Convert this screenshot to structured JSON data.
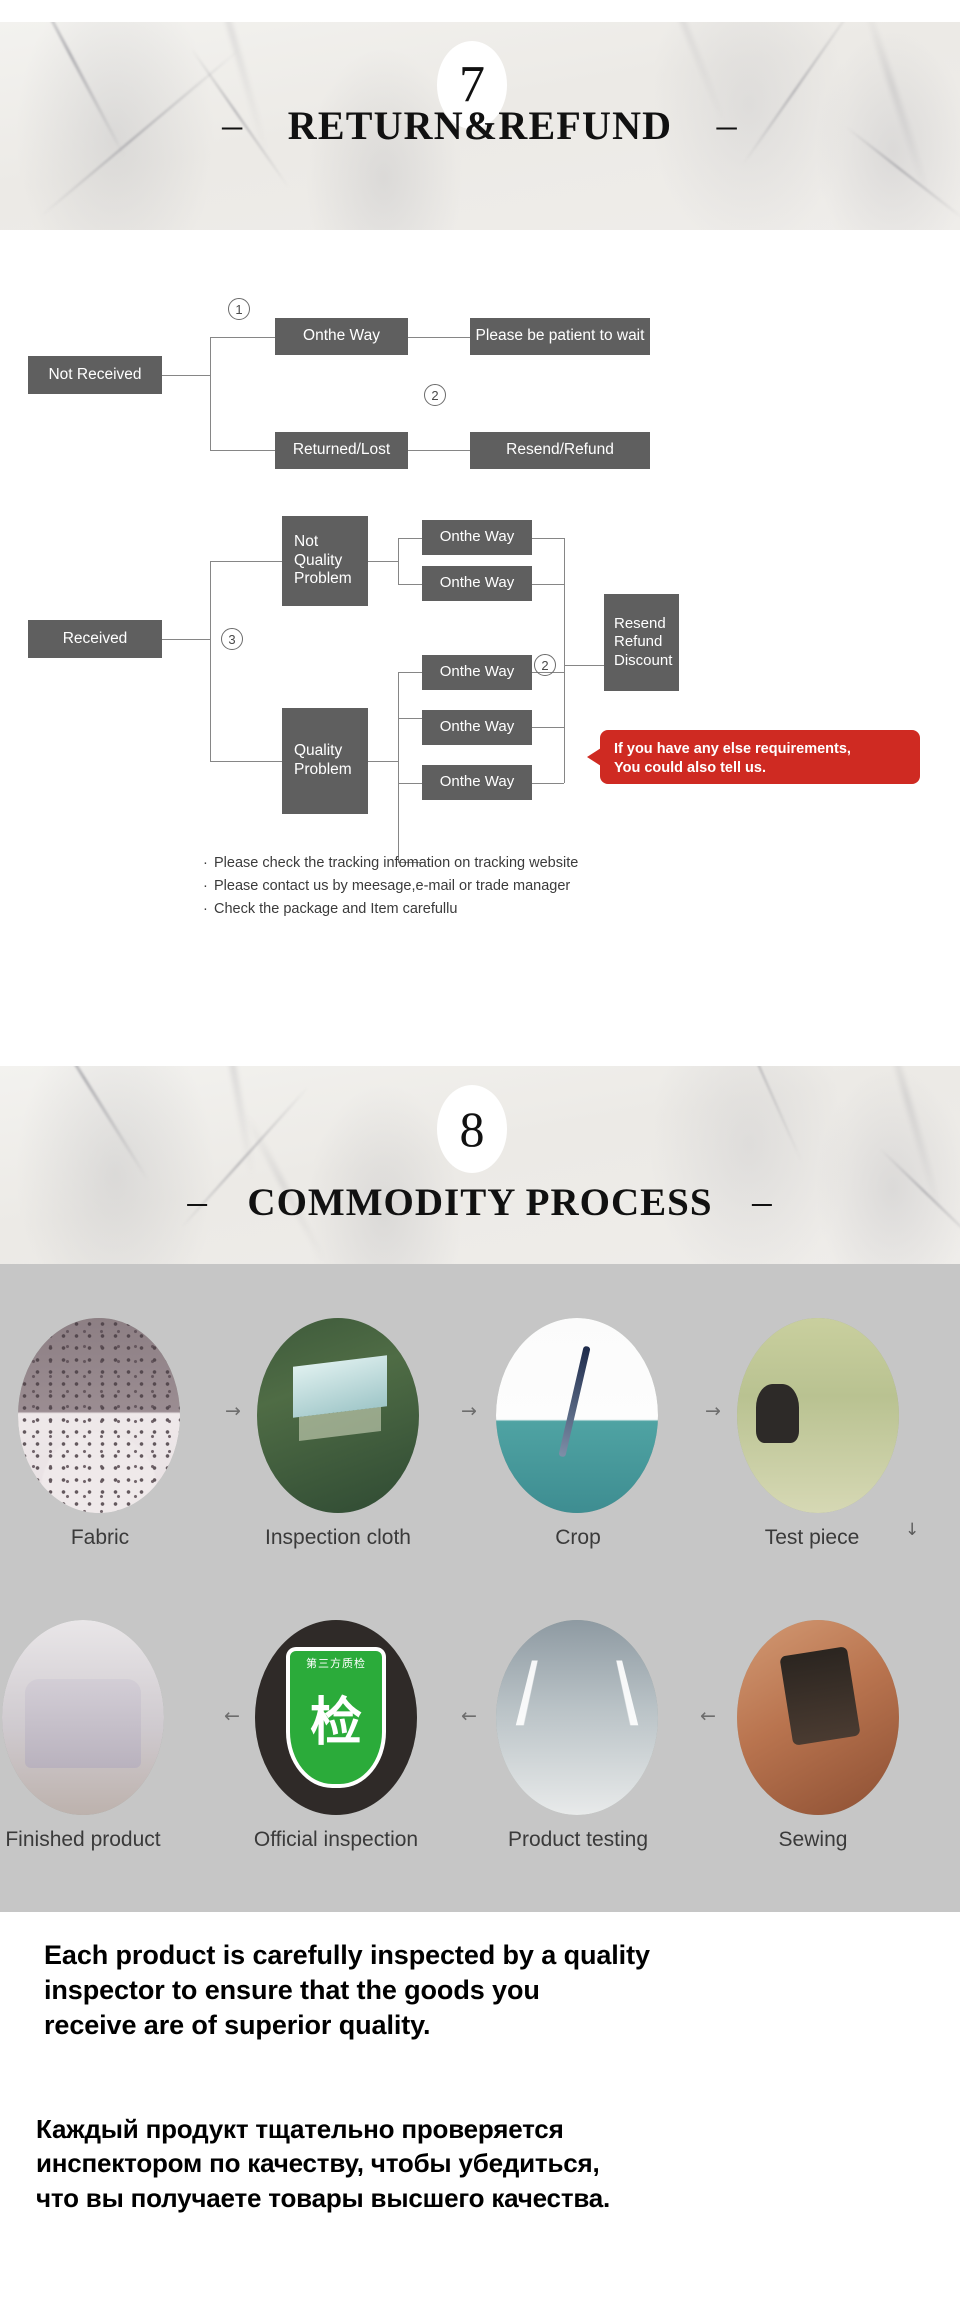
{
  "sections": [
    {
      "number": "7",
      "title": "RETURN&REFUND",
      "dash_left": "–",
      "dash_right": "–"
    },
    {
      "number": "8",
      "title": "COMMODITY PROCESS",
      "dash_left": "–",
      "dash_right": "–"
    }
  ],
  "flow1": {
    "root": "Not Received",
    "branches": [
      {
        "marker": "1",
        "step": "Onthe Way",
        "result": "Please be patient to wait"
      },
      {
        "marker": "2",
        "step": "Returned/Lost",
        "result": "Resend/Refund"
      }
    ]
  },
  "flow2": {
    "root": "Received",
    "root_marker": "3",
    "merge_marker": "2",
    "categories": [
      {
        "label": "Not Quality Problem",
        "line1": "Not",
        "line2": "Quality",
        "line3": "Problem",
        "steps": [
          "Onthe Way",
          "Onthe Way"
        ]
      },
      {
        "label": "Quality Problem",
        "line1": "Quality",
        "line2": "Problem",
        "steps": [
          "Onthe Way",
          "Onthe Way",
          "Onthe Way"
        ]
      }
    ],
    "outcome": {
      "line1": "Resend",
      "line2": "Refund",
      "line3": "Discount"
    },
    "callout": {
      "line1": "If you have any else requirements,",
      "line2": "You could also tell us."
    }
  },
  "notes": [
    "Please check the tracking infomation on tracking website",
    "Please contact us by meesage,e-mail or trade manager",
    "Check the package and Item carefullu"
  ],
  "notes_bullet": "·",
  "process": {
    "row1": [
      {
        "label": "Fabric",
        "art": "fabric"
      },
      {
        "label": "Inspection cloth",
        "art": "insp"
      },
      {
        "label": "Crop",
        "art": "crop"
      },
      {
        "label": "Test piece",
        "art": "test"
      }
    ],
    "row1_arrows": [
      "→",
      "→",
      "→"
    ],
    "row1_down_arrow": "↓",
    "row2": [
      {
        "label": "Finished product",
        "art": "finished"
      },
      {
        "label": "Official inspection",
        "art": "official"
      },
      {
        "label": "Product testing",
        "art": "testing"
      },
      {
        "label": "Sewing",
        "art": "sewing"
      }
    ],
    "row2_arrows": [
      "←",
      "←",
      "←"
    ],
    "shield_top_text": "第三方质检",
    "shield_glyph": "检"
  },
  "bottom": {
    "english": [
      "Each product is carefully inspected by a quality",
      "inspector to ensure that the goods you",
      "receive are of superior quality."
    ],
    "russian": [
      "Каждый продукт тщательно проверяется",
      "инспектором по качеству, чтобы убедиться,",
      "что вы получаете товары высшего качества."
    ]
  },
  "colors": {
    "box_gray": "#5f5f5f",
    "callout_red": "#cf2a22",
    "process_bg": "#c6c6c6",
    "banner_marble": "#eeece8",
    "shield_green": "#2bab3a"
  }
}
